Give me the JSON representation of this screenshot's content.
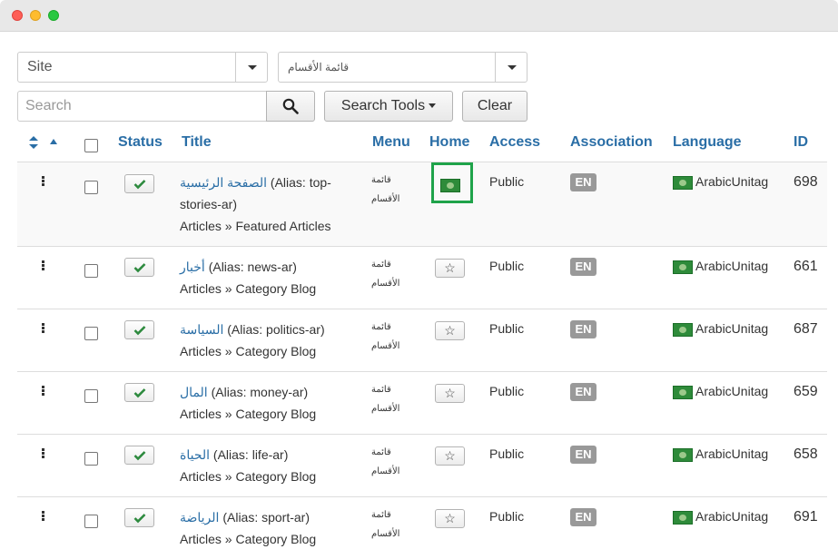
{
  "filters": {
    "client": "Site",
    "menu": "قائمة الأقسام",
    "search_placeholder": "Search",
    "search_tools_label": "Search Tools",
    "clear_label": "Clear"
  },
  "columns": {
    "status": "Status",
    "title": "Title",
    "menu": "Menu",
    "home": "Home",
    "access": "Access",
    "association": "Association",
    "language": "Language",
    "id": "ID"
  },
  "rows": [
    {
      "title": "الصفحة الرئيسية",
      "alias": "(Alias: top-",
      "alias2": "stories-ar)",
      "link_type": "Articles » Featured Articles",
      "menu_l1": "قائمة",
      "menu_l2": "الأقسام",
      "home": "flag",
      "access": "Public",
      "association": "EN",
      "language": "ArabicUnitag",
      "id": "698"
    },
    {
      "title": "أخبار",
      "alias": "(Alias: news-ar)",
      "link_type": "Articles » Category Blog",
      "menu_l1": "قائمة",
      "menu_l2": "الأقسام",
      "home": "star",
      "access": "Public",
      "association": "EN",
      "language": "ArabicUnitag",
      "id": "661"
    },
    {
      "title": "السياسة",
      "alias": "(Alias: politics-ar)",
      "link_type": "Articles » Category Blog",
      "menu_l1": "قائمة",
      "menu_l2": "الأقسام",
      "home": "star",
      "access": "Public",
      "association": "EN",
      "language": "ArabicUnitag",
      "id": "687"
    },
    {
      "title": "المال",
      "alias": "(Alias: money-ar)",
      "link_type": "Articles » Category Blog",
      "menu_l1": "قائمة",
      "menu_l2": "الأقسام",
      "home": "star",
      "access": "Public",
      "association": "EN",
      "language": "ArabicUnitag",
      "id": "659"
    },
    {
      "title": "الحياة",
      "alias": "(Alias: life-ar)",
      "link_type": "Articles » Category Blog",
      "menu_l1": "قائمة",
      "menu_l2": "الأقسام",
      "home": "star",
      "access": "Public",
      "association": "EN",
      "language": "ArabicUnitag",
      "id": "658"
    },
    {
      "title": "الرياضة",
      "alias": "(Alias: sport-ar)",
      "link_type": "Articles » Category Blog",
      "menu_l1": "قائمة",
      "menu_l2": "الأقسام",
      "home": "star",
      "access": "Public",
      "association": "EN",
      "language": "ArabicUnitag",
      "id": "691"
    }
  ],
  "icons": {
    "star": "☆"
  },
  "colors": {
    "link": "#2a6ea6",
    "home_highlight": "#1fa34a",
    "badge": "#999999"
  }
}
